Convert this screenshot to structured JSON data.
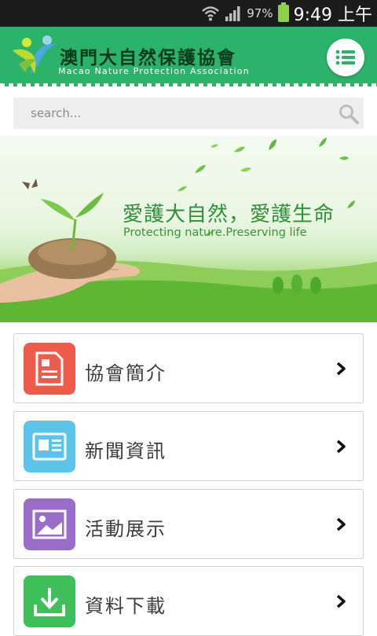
{
  "status_bar": {
    "battery_percent": "97%",
    "time": "9:49 上午",
    "icons": [
      "wifi-icon",
      "signal-icon",
      "battery-icon"
    ]
  },
  "header": {
    "logo_cn": "澳門大自然保護協會",
    "logo_en": "Macao Nature Protection Association",
    "menu_icon": "list-menu-icon",
    "background_color": "#2bb36b"
  },
  "search": {
    "placeholder": "search...",
    "value": ""
  },
  "banner": {
    "headline_cn": "愛護大自然，愛護生命",
    "headline_en": "Protecting nature.Preserving life"
  },
  "menu": [
    {
      "label": "協會簡介",
      "icon": "document-icon",
      "color": "#ee5b4b"
    },
    {
      "label": "新聞資訊",
      "icon": "news-icon",
      "color": "#5cc4e9"
    },
    {
      "label": "活動展示",
      "icon": "picture-icon",
      "color": "#9a6dcb"
    },
    {
      "label": "資料下載",
      "icon": "download-icon",
      "color": "#3fbf59"
    }
  ]
}
